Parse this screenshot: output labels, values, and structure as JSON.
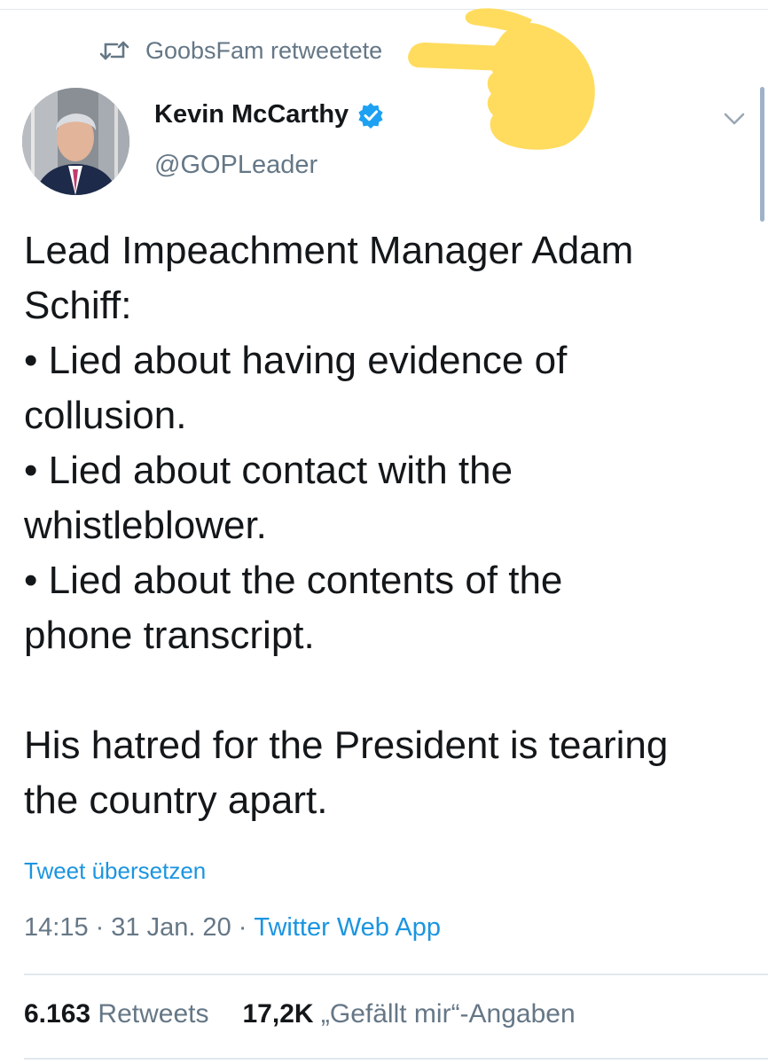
{
  "retweet": {
    "text": "GoobsFam retweetete",
    "icon": "retweet-icon"
  },
  "author": {
    "display_name": "Kevin McCarthy",
    "handle": "@GOPLeader",
    "verified_icon": "verified-badge-icon",
    "avatar_icon": "avatar"
  },
  "tweet": {
    "lines": [
      "Lead Impeachment Manager Adam",
      "Schiff:",
      "• Lied about having evidence of",
      "collusion.",
      "• Lied about contact with the",
      "whistleblower.",
      "• Lied about the contents of the",
      "phone transcript.",
      "His hatred for the President is tearing",
      "the country apart."
    ]
  },
  "translate_label": "Tweet übersetzen",
  "meta": {
    "time": "14:15",
    "sep1": "·",
    "date": "31 Jan. 20",
    "sep2": "·",
    "source": "Twitter Web App"
  },
  "stats": {
    "retweets_count": "6.163",
    "retweets_label": "Retweets",
    "likes_count": "17,2K",
    "likes_label": "„Gefällt mir“-Angaben"
  },
  "colors": {
    "accent": "#1b95e0",
    "secondary_text": "#657786",
    "verified": "#1da1f2",
    "hand_overlay": "#ffdc5e"
  }
}
